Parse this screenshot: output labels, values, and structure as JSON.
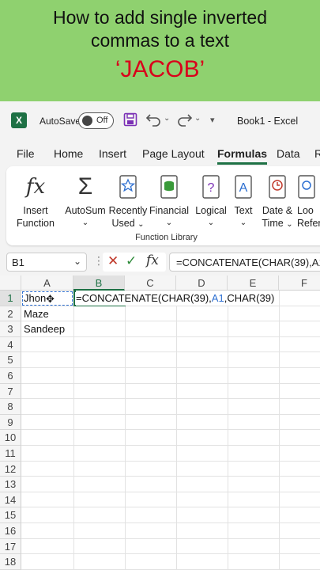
{
  "banner": {
    "line1": "How to add single inverted",
    "line2": "commas to a text",
    "line3": "‘JACOB’"
  },
  "titlebar": {
    "app_icon": "X",
    "autosave": "AutoSave",
    "toggle": "Off",
    "title": "Book1  -  Excel"
  },
  "menu": [
    "File",
    "Home",
    "Insert",
    "Page Layout",
    "Formulas",
    "Data",
    "R"
  ],
  "ribbon": {
    "insert_function": [
      "Insert",
      "Function"
    ],
    "autosum": "AutoSum",
    "recently_used": [
      "Recently",
      "Used"
    ],
    "financial": "Financial",
    "logical": "Logical",
    "text": "Text",
    "date_time": [
      "Date &",
      "Time"
    ],
    "lookup": [
      "Loo",
      "Refer"
    ],
    "group_label": "Function Library"
  },
  "namebox": "B1",
  "formula_bar": "=CONCATENATE(CHAR(39),A1,",
  "columns": [
    "A",
    "B",
    "C",
    "D",
    "E",
    "F"
  ],
  "rows": [
    "1",
    "2",
    "3",
    "4",
    "5",
    "6",
    "7",
    "8",
    "9",
    "10",
    "11",
    "12",
    "13",
    "14",
    "15",
    "16",
    "17",
    "18"
  ],
  "cells": {
    "A1": "Jhon",
    "A2": "Maze",
    "A3": "Sandeep"
  },
  "editing": {
    "p1": "=CONCATENATE(CHAR(39),",
    "ref": "A1",
    "p2": ",CHAR(39)"
  },
  "colors": {
    "excel_green": "#1e7145",
    "banner_green": "#8fd16f",
    "accent_red": "#d9001b",
    "ref_blue": "#2d6fd1"
  }
}
